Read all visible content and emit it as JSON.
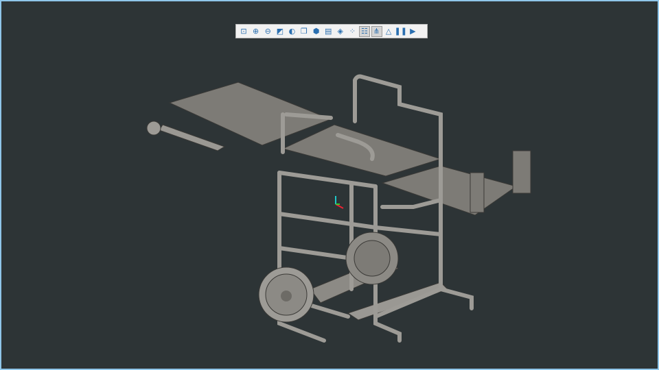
{
  "viewer": {
    "background": "#2d3436",
    "frame_color": "#8fc6ea",
    "toolbar": [
      {
        "icon": "zoom-fit-icon",
        "glyph": "⊡",
        "active": false
      },
      {
        "icon": "zoom-in-icon",
        "glyph": "⊕",
        "active": false
      },
      {
        "icon": "zoom-out-icon",
        "glyph": "⊖",
        "active": false
      },
      {
        "icon": "shading-icon",
        "glyph": "◩",
        "active": false
      },
      {
        "icon": "render-mode-icon",
        "glyph": "◐",
        "active": false
      },
      {
        "icon": "view-cube-icon",
        "glyph": "❒",
        "active": false
      },
      {
        "icon": "standard-views-icon",
        "glyph": "⬢",
        "active": false
      },
      {
        "icon": "screenshot-icon",
        "glyph": "▤",
        "active": false
      },
      {
        "icon": "section-icon",
        "glyph": "◈",
        "active": false
      },
      {
        "icon": "explode-icon",
        "glyph": "⁘",
        "active": false
      },
      {
        "icon": "model-tree-icon",
        "glyph": "☷",
        "active": true
      },
      {
        "icon": "assembly-structure-icon",
        "glyph": "⋔",
        "active": true
      },
      {
        "icon": "measure-icon",
        "glyph": "△",
        "active": false
      },
      {
        "icon": "pause-icon",
        "glyph": "❚❚",
        "active": false
      },
      {
        "icon": "presentation-icon",
        "glyph": "▶",
        "active": false
      }
    ]
  }
}
